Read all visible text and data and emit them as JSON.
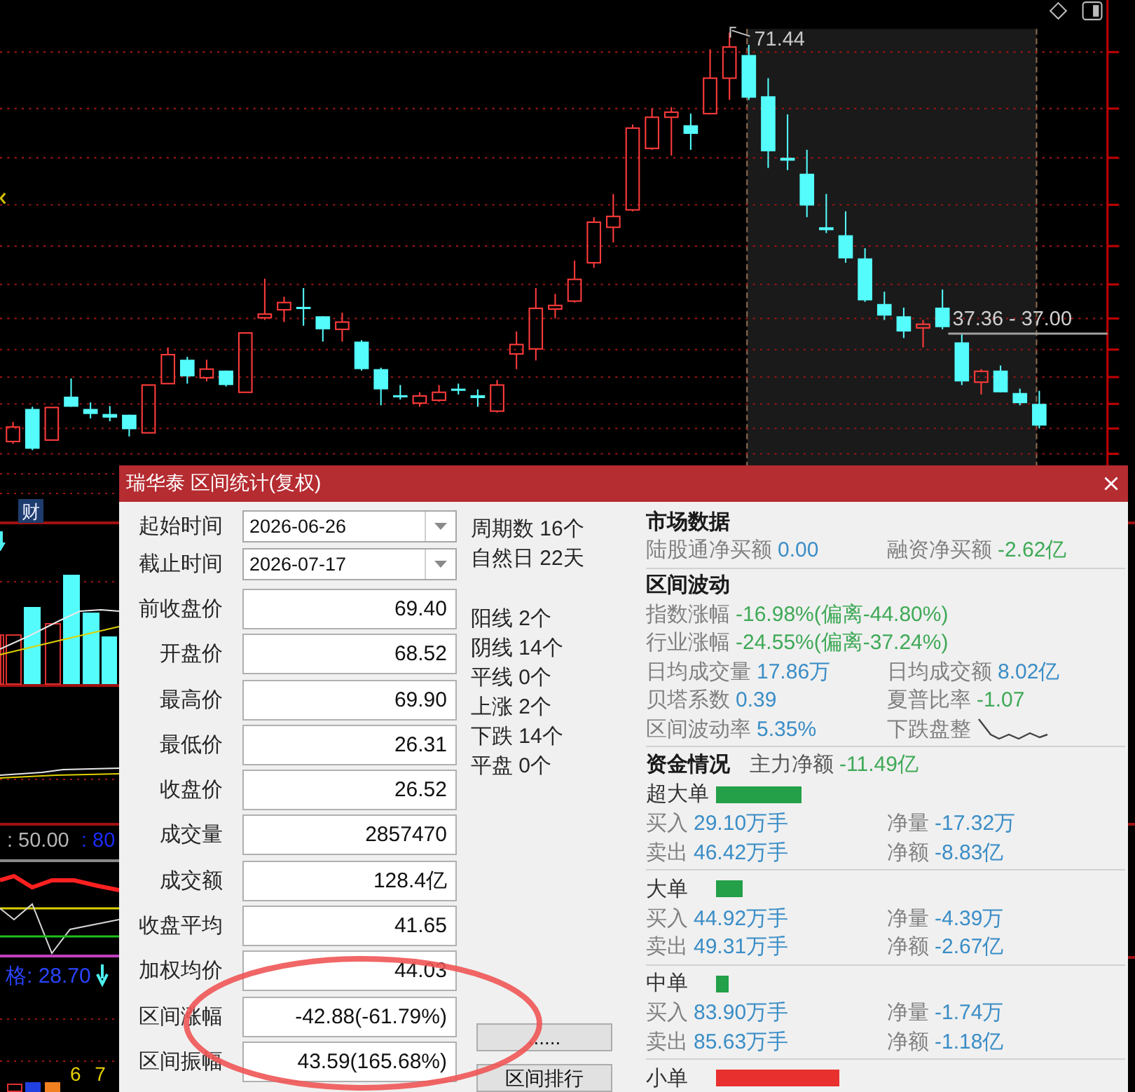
{
  "chart": {
    "peak_label": "71.44",
    "level_label": "37.36 - 37.00"
  },
  "side_panel": {
    "tag": "财",
    "readouts": [
      {
        "text": ": 50.00",
        "color": "#b8b8b8"
      },
      {
        "text": ": 80",
        "color": "#1a2cff"
      }
    ],
    "price_readout": "格: 28.70",
    "footer_numbers": "6 7"
  },
  "dialog": {
    "title": "瑞华泰 区间统计(复权)",
    "date_fields": [
      {
        "label": "起始时间",
        "value": "2026-06-26"
      },
      {
        "label": "截止时间",
        "value": "2026-07-17"
      }
    ],
    "stat_fields": [
      {
        "label": "前收盘价",
        "value": "69.40"
      },
      {
        "label": "开盘价",
        "value": "68.52"
      },
      {
        "label": "最高价",
        "value": "69.90"
      },
      {
        "label": "最低价",
        "value": "26.31"
      },
      {
        "label": "收盘价",
        "value": "26.52"
      },
      {
        "label": "成交量",
        "value": "2857470"
      },
      {
        "label": "成交额",
        "value": "128.4亿"
      },
      {
        "label": "收盘平均",
        "value": "41.65"
      },
      {
        "label": "加权均价",
        "value": "44.03"
      },
      {
        "label": "区间涨幅",
        "value": "-42.88(-61.79%)"
      },
      {
        "label": "区间振幅",
        "value": "43.59(165.68%)"
      }
    ],
    "period_counts": [
      "周期数 16个",
      "自然日 22天"
    ],
    "candle_counts": [
      "阳线 2个",
      "阴线 14个",
      "平线 0个",
      "上涨 2个",
      "下跌 14个",
      "平盘 0个"
    ],
    "buttons": [
      {
        "label": "......"
      },
      {
        "label": "区间排行"
      }
    ],
    "sections": [
      {
        "title": "市场数据",
        "rows": [
          [
            {
              "kind": "stat",
              "label": "陆股通净买额",
              "value": "0.00",
              "color": "#3a8dc6"
            },
            {
              "kind": "stat",
              "label": "融资净买额",
              "value": "-2.62亿",
              "color": "#3fa957"
            }
          ]
        ]
      },
      {
        "title": "区间波动",
        "rows": [
          [
            {
              "kind": "stat",
              "label": "指数涨幅",
              "value": "-16.98%(偏离-44.80%)",
              "color": "#3fa957"
            }
          ],
          [
            {
              "kind": "stat",
              "label": "行业涨幅",
              "value": "-24.55%(偏离-37.24%)",
              "color": "#3fa957"
            }
          ],
          [
            {
              "kind": "stat",
              "label": "日均成交量",
              "value": "17.86万",
              "color": "#3a8dc6"
            },
            {
              "kind": "stat",
              "label": "日均成交额",
              "value": "8.02亿",
              "color": "#3a8dc6"
            }
          ],
          [
            {
              "kind": "stat",
              "label": "贝塔系数",
              "value": "0.39",
              "color": "#3a8dc6"
            },
            {
              "kind": "stat",
              "label": "夏普比率",
              "value": "-1.07",
              "color": "#3fa957"
            }
          ],
          [
            {
              "kind": "stat",
              "label": "区间波动率",
              "value": "5.35%",
              "color": "#3a8dc6"
            },
            {
              "kind": "pattern",
              "label": "下跌盘整"
            }
          ]
        ]
      }
    ],
    "funds": {
      "title": "资金情况",
      "headline": {
        "label": "主力净额",
        "value": "-11.49亿"
      },
      "orders": [
        {
          "name": "超大单",
          "color": "#23a048",
          "rows": [
            [
              {
                "label": "买入",
                "value": "29.10万手"
              },
              {
                "label": "净量",
                "value": "-17.32万"
              }
            ],
            [
              {
                "label": "卖出",
                "value": "46.42万手"
              },
              {
                "label": "净额",
                "value": "-8.83亿"
              }
            ]
          ]
        },
        {
          "name": "大单",
          "color": "#23a048",
          "rows": [
            [
              {
                "label": "买入",
                "value": "44.92万手"
              },
              {
                "label": "净量",
                "value": "-4.39万"
              }
            ],
            [
              {
                "label": "卖出",
                "value": "49.31万手"
              },
              {
                "label": "净额",
                "value": "-2.67亿"
              }
            ]
          ]
        },
        {
          "name": "中单",
          "color": "#23a048",
          "rows": [
            [
              {
                "label": "买入",
                "value": "83.90万手"
              },
              {
                "label": "净量",
                "value": "-1.74万"
              }
            ],
            [
              {
                "label": "卖出",
                "value": "85.63万手"
              },
              {
                "label": "净额",
                "value": "-1.18亿"
              }
            ]
          ]
        },
        {
          "name": "小单",
          "color": "#e8302f"
        }
      ]
    }
  }
}
